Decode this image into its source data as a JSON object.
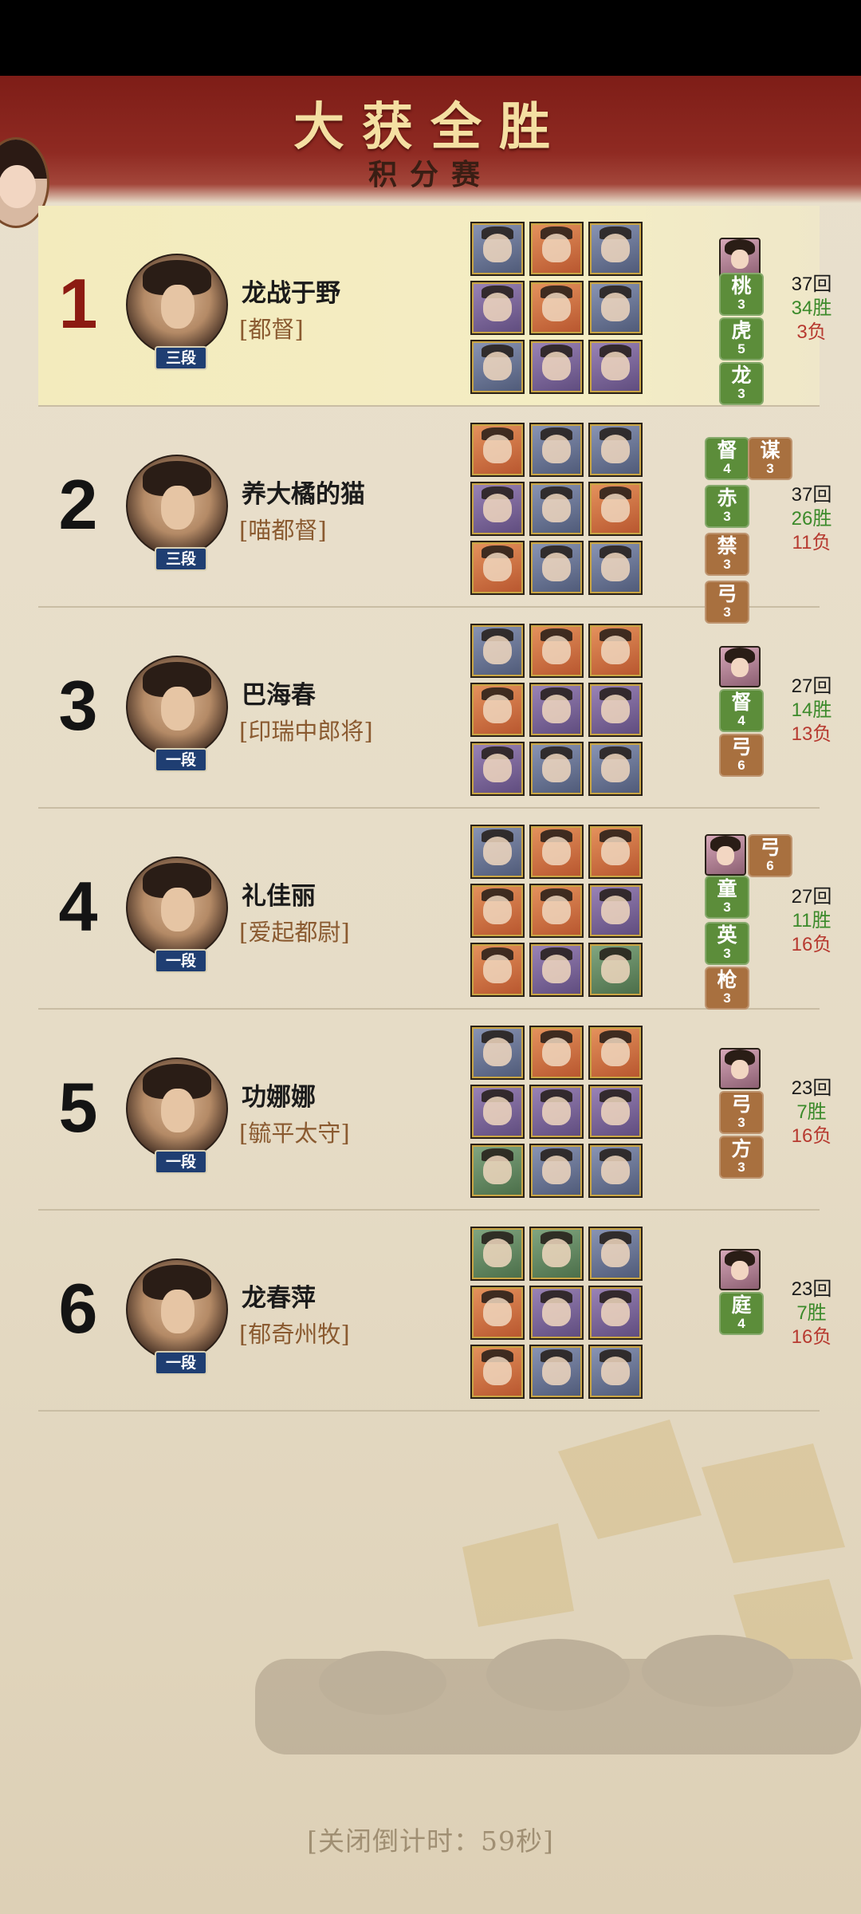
{
  "header": {
    "title": "大获全胜",
    "subtitle": "积分赛"
  },
  "players": [
    {
      "rank": "1",
      "name": "龙战于野",
      "title": "[都督]",
      "dan": "三段",
      "heroes": [
        "blue",
        "orange",
        "blue",
        "purple",
        "orange",
        "blue",
        "blue",
        "purple",
        "purple"
      ],
      "has_mini_avatar": true,
      "tags": [
        {
          "t": "桃",
          "n": "3",
          "c": "g"
        },
        {
          "t": "虎",
          "n": "5",
          "c": "g"
        },
        {
          "t": "龙",
          "n": "3",
          "c": "g"
        }
      ],
      "stats": {
        "rounds": "37回",
        "wins": "34胜",
        "losses": "3负"
      }
    },
    {
      "rank": "2",
      "name": "养大橘的猫",
      "title": "[喵都督]",
      "dan": "三段",
      "heroes": [
        "orange",
        "blue",
        "blue",
        "purple",
        "blue",
        "orange",
        "orange",
        "blue",
        "blue"
      ],
      "has_mini_avatar": false,
      "tags": [
        {
          "t": "督",
          "n": "4",
          "c": "g"
        },
        {
          "t": "谋",
          "n": "3",
          "c": "b"
        },
        {
          "t": "赤",
          "n": "3",
          "c": "g"
        },
        {
          "t": "禁",
          "n": "3",
          "c": "b"
        },
        {
          "t": "弓",
          "n": "3",
          "c": "b"
        }
      ],
      "stats": {
        "rounds": "37回",
        "wins": "26胜",
        "losses": "11负"
      }
    },
    {
      "rank": "3",
      "name": "巴海春",
      "title": "[印瑞中郎将]",
      "dan": "一段",
      "heroes": [
        "blue",
        "orange",
        "orange",
        "orange",
        "purple",
        "purple",
        "purple",
        "blue",
        "blue"
      ],
      "has_mini_avatar": true,
      "tags": [
        {
          "t": "督",
          "n": "4",
          "c": "g"
        },
        {
          "t": "弓",
          "n": "6",
          "c": "b"
        }
      ],
      "stats": {
        "rounds": "27回",
        "wins": "14胜",
        "losses": "13负"
      }
    },
    {
      "rank": "4",
      "name": "礼佳丽",
      "title": "[爱起都尉]",
      "dan": "一段",
      "heroes": [
        "blue",
        "orange",
        "orange",
        "orange",
        "orange",
        "purple",
        "orange",
        "purple",
        "green"
      ],
      "has_mini_avatar": true,
      "tags": [
        {
          "t": "弓",
          "n": "6",
          "c": "b"
        },
        {
          "t": "童",
          "n": "3",
          "c": "g"
        },
        {
          "t": "英",
          "n": "3",
          "c": "g"
        },
        {
          "t": "枪",
          "n": "3",
          "c": "b"
        }
      ],
      "stats": {
        "rounds": "27回",
        "wins": "11胜",
        "losses": "16负"
      }
    },
    {
      "rank": "5",
      "name": "功娜娜",
      "title": "[毓平太守]",
      "dan": "一段",
      "heroes": [
        "blue",
        "orange",
        "orange",
        "purple",
        "purple",
        "purple",
        "green",
        "blue",
        "blue"
      ],
      "has_mini_avatar": true,
      "tags": [
        {
          "t": "弓",
          "n": "3",
          "c": "b"
        },
        {
          "t": "方",
          "n": "3",
          "c": "b"
        }
      ],
      "stats": {
        "rounds": "23回",
        "wins": "7胜",
        "losses": "16负"
      }
    },
    {
      "rank": "6",
      "name": "龙春萍",
      "title": "[郁奇州牧]",
      "dan": "一段",
      "heroes": [
        "green",
        "green",
        "blue",
        "orange",
        "purple",
        "purple",
        "orange",
        "blue",
        "blue"
      ],
      "has_mini_avatar": true,
      "tags": [
        {
          "t": "庭",
          "n": "4",
          "c": "g"
        }
      ],
      "stats": {
        "rounds": "23回",
        "wins": "7胜",
        "losses": "16负"
      }
    }
  ],
  "footer": {
    "countdown": "[关闭倒计时：59秒]"
  }
}
